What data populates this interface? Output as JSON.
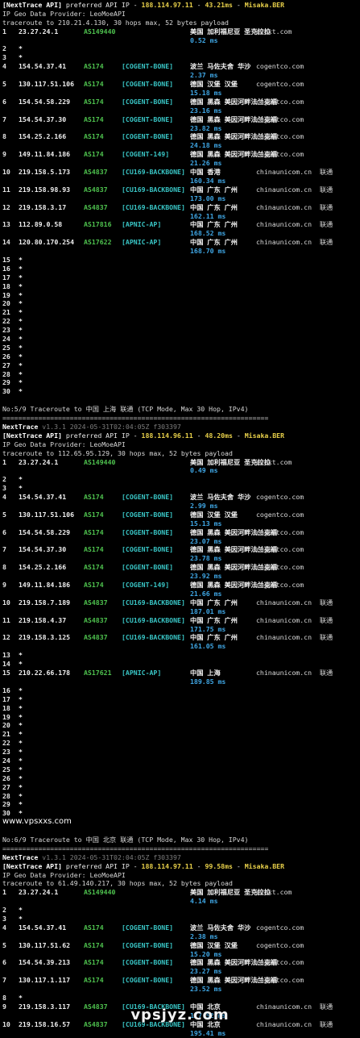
{
  "sections": [
    {
      "title_line": "",
      "separator": "",
      "nexttrace": "",
      "api_prefix": "[NextTrace API]",
      "api_text": " preferred API IP - ",
      "api_ip": "188.114.97.11",
      "api_dash": " - ",
      "api_ms": "43.21ms",
      "api_dash2": " - ",
      "api_node": "Misaka.BER",
      "geo_provider": "IP Geo Data Provider: LeoMoeAPI",
      "traceroute": "traceroute to 210.21.4.130, 30 hops max, 52 bytes payload",
      "hops": [
        {
          "n": "1",
          "ip": "23.27.24.1",
          "as": "AS149440",
          "tag": "",
          "geo": "美国 加利福尼亚 圣克拉拉",
          "dom": "evoxt.com",
          "rtt": "0.52 ms"
        },
        {
          "n": "2",
          "ip": "*"
        },
        {
          "n": "3",
          "ip": "*"
        },
        {
          "n": "4",
          "ip": "154.54.37.41",
          "as": "AS174",
          "tag": "[COGENT-BONE]",
          "geo": "波兰 马佐夫舍 华沙",
          "dom": "cogentco.com",
          "rtt": "2.37 ms"
        },
        {
          "n": "5",
          "ip": "130.117.51.106",
          "as": "AS174",
          "tag": "[COGENT-BONE]",
          "geo": "德国 汉堡 汉堡",
          "dom": "cogentco.com",
          "rtt": "15.18 ms"
        },
        {
          "n": "6",
          "ip": "154.54.58.229",
          "as": "AS174",
          "tag": "[COGENT-BONE]",
          "geo": "德国 黑森 美因河畔法兰克福",
          "dom": "cogentco.com",
          "rtt": "23.16 ms"
        },
        {
          "n": "7",
          "ip": "154.54.37.30",
          "as": "AS174",
          "tag": "[COGENT-BONE]",
          "geo": "德国 黑森 美因河畔法兰克福",
          "dom": "cogentco.com",
          "rtt": "23.82 ms"
        },
        {
          "n": "8",
          "ip": "154.25.2.166",
          "as": "AS174",
          "tag": "[COGENT-BONE]",
          "geo": "德国 黑森 美因河畔法兰克福",
          "dom": "cogentco.com",
          "rtt": "24.18 ms"
        },
        {
          "n": "9",
          "ip": "149.11.84.186",
          "as": "AS174",
          "tag": "[COGENT-149]",
          "geo": "德国 黑森 美因河畔法兰克福",
          "dom": "cogentco.com",
          "rtt": "21.26 ms"
        },
        {
          "n": "10",
          "ip": "219.158.5.173",
          "as": "AS4837",
          "tag": "[CU169-BACKBONE]",
          "geo": "中国 香港",
          "dom": "chinaunicom.cn  联通",
          "rtt": "160.34 ms"
        },
        {
          "n": "11",
          "ip": "219.158.98.93",
          "as": "AS4837",
          "tag": "[CU169-BACKBONE]",
          "geo": "中国 广东 广州",
          "dom": "chinaunicom.cn  联通",
          "rtt": "173.00 ms"
        },
        {
          "n": "12",
          "ip": "219.158.3.17",
          "as": "AS4837",
          "tag": "[CU169-BACKBONE]",
          "geo": "中国 广东 广州",
          "dom": "chinaunicom.cn  联通",
          "rtt": "162.11 ms"
        },
        {
          "n": "13",
          "ip": "112.89.0.58",
          "as": "AS17816",
          "tag": "[APNIC-AP]",
          "geo": "中国 广东 广州",
          "dom": "chinaunicom.cn  联通",
          "rtt": "168.52 ms"
        },
        {
          "n": "14",
          "ip": "120.80.170.254",
          "as": "AS17622",
          "tag": "[APNIC-AP]",
          "geo": "中国 广东 广州",
          "dom": "chinaunicom.cn  联通",
          "rtt": "168.70 ms"
        },
        {
          "n": "15",
          "ip": "*"
        },
        {
          "n": "16",
          "ip": "*"
        },
        {
          "n": "17",
          "ip": "*"
        },
        {
          "n": "18",
          "ip": "*"
        },
        {
          "n": "19",
          "ip": "*"
        },
        {
          "n": "20",
          "ip": "*"
        },
        {
          "n": "21",
          "ip": "*"
        },
        {
          "n": "22",
          "ip": "*"
        },
        {
          "n": "23",
          "ip": "*"
        },
        {
          "n": "24",
          "ip": "*"
        },
        {
          "n": "25",
          "ip": "*"
        },
        {
          "n": "26",
          "ip": "*"
        },
        {
          "n": "27",
          "ip": "*"
        },
        {
          "n": "28",
          "ip": "*"
        },
        {
          "n": "29",
          "ip": "*"
        },
        {
          "n": "30",
          "ip": "*"
        }
      ]
    },
    {
      "title_line": "No:5/9 Traceroute to 中国 上海 联通 (TCP Mode, Max 30 Hop, IPv4)",
      "separator": "===================================================================",
      "nexttrace": "NextTrace",
      "nexttrace_ver": " v1.3.1 2024-05-31T02:04:05Z f303397",
      "api_prefix": "[NextTrace API]",
      "api_text": " preferred API IP - ",
      "api_ip": "188.114.96.11",
      "api_dash": " - ",
      "api_ms": "48.20ms",
      "api_dash2": " - ",
      "api_node": "Misaka.BER",
      "geo_provider": "IP Geo Data Provider: LeoMoeAPI",
      "traceroute": "traceroute to 112.65.95.129, 30 hops max, 52 bytes payload",
      "hops": [
        {
          "n": "1",
          "ip": "23.27.24.1",
          "as": "AS149440",
          "tag": "",
          "geo": "美国 加利福尼亚 圣克拉拉",
          "dom": "evoxt.com",
          "rtt": "0.49 ms"
        },
        {
          "n": "2",
          "ip": "*"
        },
        {
          "n": "3",
          "ip": "*"
        },
        {
          "n": "4",
          "ip": "154.54.37.41",
          "as": "AS174",
          "tag": "[COGENT-BONE]",
          "geo": "波兰 马佐夫舍 华沙",
          "dom": "cogentco.com",
          "rtt": "2.99 ms"
        },
        {
          "n": "5",
          "ip": "130.117.51.106",
          "as": "AS174",
          "tag": "[COGENT-BONE]",
          "geo": "德国 汉堡 汉堡",
          "dom": "cogentco.com",
          "rtt": "15.13 ms"
        },
        {
          "n": "6",
          "ip": "154.54.58.229",
          "as": "AS174",
          "tag": "[COGENT-BONE]",
          "geo": "德国 黑森 美因河畔法兰克福",
          "dom": "cogentco.com",
          "rtt": "23.07 ms"
        },
        {
          "n": "7",
          "ip": "154.54.37.30",
          "as": "AS174",
          "tag": "[COGENT-BONE]",
          "geo": "德国 黑森 美因河畔法兰克福",
          "dom": "cogentco.com",
          "rtt": "23.78 ms"
        },
        {
          "n": "8",
          "ip": "154.25.2.166",
          "as": "AS174",
          "tag": "[COGENT-BONE]",
          "geo": "德国 黑森 美因河畔法兰克福",
          "dom": "cogentco.com",
          "rtt": "23.92 ms"
        },
        {
          "n": "9",
          "ip": "149.11.84.186",
          "as": "AS174",
          "tag": "[COGENT-149]",
          "geo": "德国 黑森 美因河畔法兰克福",
          "dom": "cogentco.com",
          "rtt": "21.66 ms"
        },
        {
          "n": "10",
          "ip": "219.158.7.189",
          "as": "AS4837",
          "tag": "[CU169-BACKBONE]",
          "geo": "中国 广东 广州",
          "dom": "chinaunicom.cn  联通",
          "rtt": "187.01 ms"
        },
        {
          "n": "11",
          "ip": "219.158.4.37",
          "as": "AS4837",
          "tag": "[CU169-BACKBONE]",
          "geo": "中国 广东 广州",
          "dom": "chinaunicom.cn  联通",
          "rtt": "171.75 ms"
        },
        {
          "n": "12",
          "ip": "219.158.3.125",
          "as": "AS4837",
          "tag": "[CU169-BACKBONE]",
          "geo": "中国 广东 广州",
          "dom": "chinaunicom.cn  联通",
          "rtt": "161.05 ms"
        },
        {
          "n": "13",
          "ip": "*"
        },
        {
          "n": "14",
          "ip": "*"
        },
        {
          "n": "15",
          "ip": "210.22.66.178",
          "as": "AS17621",
          "tag": "[APNIC-AP]",
          "geo": "中国 上海",
          "dom": "chinaunicom.cn  联通",
          "rtt": "189.85 ms"
        },
        {
          "n": "16",
          "ip": "*"
        },
        {
          "n": "17",
          "ip": "*"
        },
        {
          "n": "18",
          "ip": "*"
        },
        {
          "n": "19",
          "ip": "*"
        },
        {
          "n": "20",
          "ip": "*"
        },
        {
          "n": "21",
          "ip": "*"
        },
        {
          "n": "22",
          "ip": "*"
        },
        {
          "n": "23",
          "ip": "*"
        },
        {
          "n": "24",
          "ip": "*"
        },
        {
          "n": "25",
          "ip": "*"
        },
        {
          "n": "26",
          "ip": "*"
        },
        {
          "n": "27",
          "ip": "*"
        },
        {
          "n": "28",
          "ip": "*"
        },
        {
          "n": "29",
          "ip": "*"
        },
        {
          "n": "30",
          "ip": "*"
        }
      ],
      "site_after": "www.vpsxxs.com"
    },
    {
      "title_line": "No:6/9 Traceroute to 中国 北京 联通 (TCP Mode, Max 30 Hop, IPv4)",
      "separator": "===================================================================",
      "nexttrace": "NextTrace",
      "nexttrace_ver": " v1.3.1 2024-05-31T02:04:05Z f303397",
      "api_prefix": "[NextTrace API]",
      "api_text": " preferred API IP - ",
      "api_ip": "188.114.97.11",
      "api_dash": " - ",
      "api_ms": "99.58ms",
      "api_dash2": " - ",
      "api_node": "Misaka.BER",
      "geo_provider": "IP Geo Data Provider: LeoMoeAPI",
      "traceroute": "traceroute to 61.49.140.217, 30 hops max, 52 bytes payload",
      "hops": [
        {
          "n": "1",
          "ip": "23.27.24.1",
          "as": "AS149440",
          "tag": "",
          "geo": "美国 加利福尼亚 圣克拉拉",
          "dom": "evoxt.com",
          "rtt": "4.14 ms"
        },
        {
          "n": "2",
          "ip": "*"
        },
        {
          "n": "3",
          "ip": "*"
        },
        {
          "n": "4",
          "ip": "154.54.37.41",
          "as": "AS174",
          "tag": "[COGENT-BONE]",
          "geo": "波兰 马佐夫舍 华沙",
          "dom": "cogentco.com",
          "rtt": "2.38 ms"
        },
        {
          "n": "5",
          "ip": "130.117.51.62",
          "as": "AS174",
          "tag": "[COGENT-BONE]",
          "geo": "德国 汉堡 汉堡",
          "dom": "cogentco.com",
          "rtt": "15.20 ms"
        },
        {
          "n": "6",
          "ip": "154.54.39.213",
          "as": "AS174",
          "tag": "[COGENT-BONE]",
          "geo": "德国 黑森 美因河畔法兰克福",
          "dom": "cogentco.com",
          "rtt": "23.27 ms"
        },
        {
          "n": "7",
          "ip": "130.117.1.117",
          "as": "AS174",
          "tag": "[COGENT-BONE]",
          "geo": "德国 黑森 美因河畔法兰克福",
          "dom": "cogentco.com",
          "rtt": "23.52 ms"
        },
        {
          "n": "8",
          "ip": "*"
        },
        {
          "n": "9",
          "ip": "219.158.3.117",
          "as": "AS4837",
          "tag": "[CU169-BACKBONE]",
          "geo": "中国 北京",
          "dom": "chinaunicom.cn  联通",
          "rtt": "177.52 ms"
        },
        {
          "n": "10",
          "ip": "219.158.16.57",
          "as": "AS4837",
          "tag": "[CU169-BACKBONE]",
          "geo": "中国 北京",
          "dom": "chinaunicom.cn  联通",
          "rtt": "195.41 ms"
        }
      ]
    }
  ],
  "watermark": "vpsjyz.com"
}
